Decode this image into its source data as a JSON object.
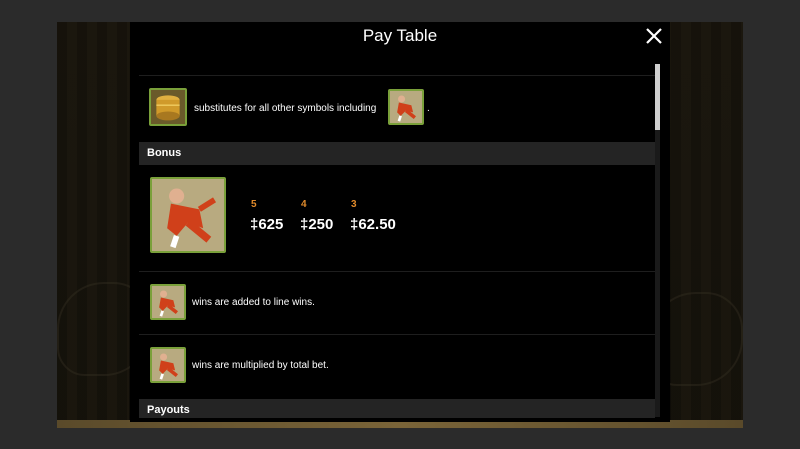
{
  "modal": {
    "title": "Pay Table"
  },
  "wild": {
    "text": "substitutes for all other symbols including",
    "trailing": "."
  },
  "bonus": {
    "header": "Bonus",
    "pays": [
      {
        "count": "5",
        "amount": "‡625"
      },
      {
        "count": "4",
        "amount": "‡250"
      },
      {
        "count": "3",
        "amount": "‡62.50"
      }
    ],
    "note1": "wins are added to line wins.",
    "note2": "wins are multiplied by total bet."
  },
  "payouts": {
    "header": "Payouts"
  },
  "icons": {
    "close": "close-icon",
    "wild_symbol": "golden-drum-symbol-icon",
    "bonus_symbol": "kung-fu-monk-symbol-icon"
  },
  "colors": {
    "multiplier": "#e08a2b",
    "frame": "#7aa03a",
    "section_bg": "#242424"
  },
  "scroll": {
    "position": 0
  }
}
